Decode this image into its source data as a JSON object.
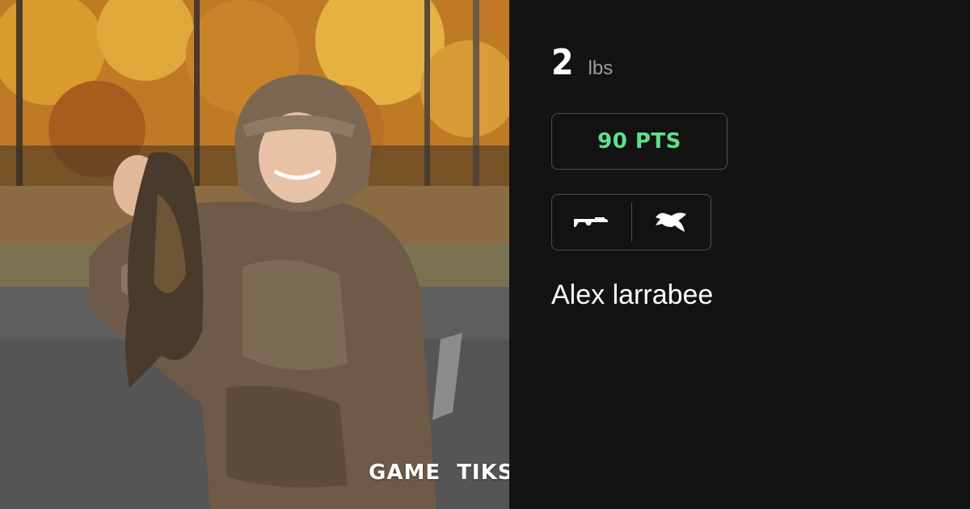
{
  "photo": {
    "description_icon": "hunter-photo",
    "watermark": "GAME  TIKS"
  },
  "catch": {
    "weight_value": "2",
    "weight_unit": "lbs",
    "points": "90 PTS",
    "weapon_icon": "shotgun-icon",
    "species_icon": "bird-icon",
    "hunter_name": "Alex larrabee"
  },
  "colors": {
    "background": "#131313",
    "points_accent": "#5fe08a",
    "border": "#4a4d52",
    "unit_gray": "#9a9ea3"
  }
}
